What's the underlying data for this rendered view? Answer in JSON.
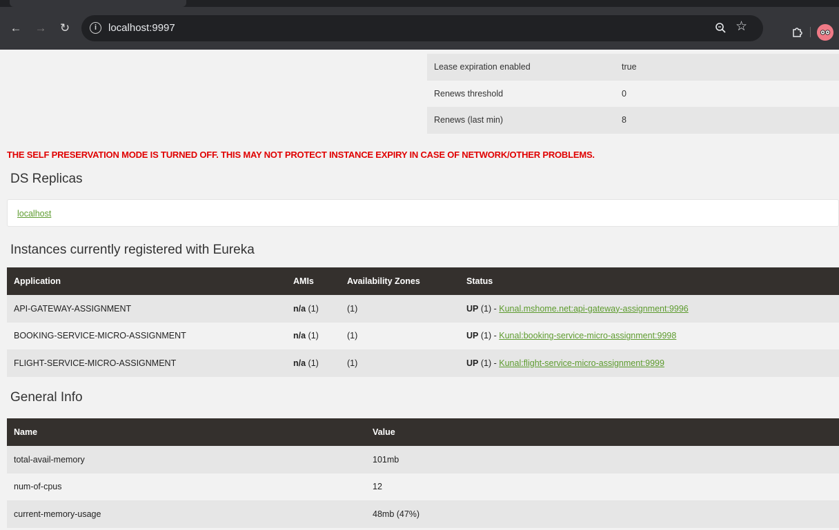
{
  "browser": {
    "url": "localhost:9997",
    "icons": {
      "back": "back-arrow-icon",
      "forward": "forward-arrow-icon",
      "reload": "reload-icon",
      "info": "site-info-icon",
      "zoom": "zoom-icon",
      "bookmark": "star-icon",
      "extensions": "puzzle-icon",
      "profile": "avatar-icon"
    }
  },
  "lease_info": [
    {
      "name": "Lease expiration enabled",
      "value": "true"
    },
    {
      "name": "Renews threshold",
      "value": "0"
    },
    {
      "name": "Renews (last min)",
      "value": "8"
    }
  ],
  "warning": "THE SELF PRESERVATION MODE IS TURNED OFF. THIS MAY NOT PROTECT INSTANCE EXPIRY IN CASE OF NETWORK/OTHER PROBLEMS.",
  "replicas": {
    "title": "DS Replicas",
    "items": [
      "localhost"
    ]
  },
  "instances": {
    "title": "Instances currently registered with Eureka",
    "headers": [
      "Application",
      "AMIs",
      "Availability Zones",
      "Status"
    ],
    "rows": [
      {
        "application": "API-GATEWAY-ASSIGNMENT",
        "amis_prefix": "n/a",
        "amis_count": "(1)",
        "zones": "(1)",
        "status_prefix": "UP",
        "status_count": "(1) -",
        "status_link": "Kunal.mshome.net:api-gateway-assignment:9996"
      },
      {
        "application": "BOOKING-SERVICE-MICRO-ASSIGNMENT",
        "amis_prefix": "n/a",
        "amis_count": "(1)",
        "zones": "(1)",
        "status_prefix": "UP",
        "status_count": "(1) -",
        "status_link": "Kunal:booking-service-micro-assignment:9998"
      },
      {
        "application": "FLIGHT-SERVICE-MICRO-ASSIGNMENT",
        "amis_prefix": "n/a",
        "amis_count": "(1)",
        "zones": "(1)",
        "status_prefix": "UP",
        "status_count": "(1) -",
        "status_link": "Kunal:flight-service-micro-assignment:9999"
      }
    ]
  },
  "general_info": {
    "title": "General Info",
    "headers": [
      "Name",
      "Value"
    ],
    "rows": [
      {
        "name": "total-avail-memory",
        "value": "101mb"
      },
      {
        "name": "num-of-cpus",
        "value": "12"
      },
      {
        "name": "current-memory-usage",
        "value": "48mb (47%)"
      }
    ]
  },
  "colors": {
    "header_bg": "#34302d",
    "link": "#5d9b2e",
    "warning": "#e00000",
    "row_odd": "#e6e6e6",
    "row_even": "#f2f2f2"
  }
}
